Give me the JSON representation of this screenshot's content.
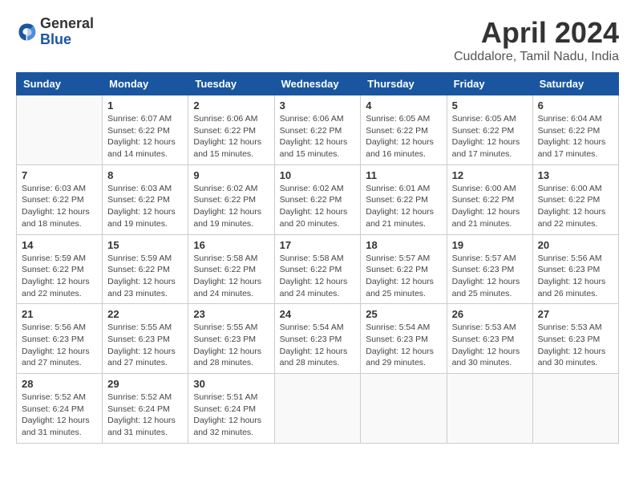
{
  "logo": {
    "general": "General",
    "blue": "Blue"
  },
  "title": "April 2024",
  "subtitle": "Cuddalore, Tamil Nadu, India",
  "days_header": [
    "Sunday",
    "Monday",
    "Tuesday",
    "Wednesday",
    "Thursday",
    "Friday",
    "Saturday"
  ],
  "weeks": [
    [
      {
        "day": "",
        "info": ""
      },
      {
        "day": "1",
        "info": "Sunrise: 6:07 AM\nSunset: 6:22 PM\nDaylight: 12 hours\nand 14 minutes."
      },
      {
        "day": "2",
        "info": "Sunrise: 6:06 AM\nSunset: 6:22 PM\nDaylight: 12 hours\nand 15 minutes."
      },
      {
        "day": "3",
        "info": "Sunrise: 6:06 AM\nSunset: 6:22 PM\nDaylight: 12 hours\nand 15 minutes."
      },
      {
        "day": "4",
        "info": "Sunrise: 6:05 AM\nSunset: 6:22 PM\nDaylight: 12 hours\nand 16 minutes."
      },
      {
        "day": "5",
        "info": "Sunrise: 6:05 AM\nSunset: 6:22 PM\nDaylight: 12 hours\nand 17 minutes."
      },
      {
        "day": "6",
        "info": "Sunrise: 6:04 AM\nSunset: 6:22 PM\nDaylight: 12 hours\nand 17 minutes."
      }
    ],
    [
      {
        "day": "7",
        "info": "Sunrise: 6:03 AM\nSunset: 6:22 PM\nDaylight: 12 hours\nand 18 minutes."
      },
      {
        "day": "8",
        "info": "Sunrise: 6:03 AM\nSunset: 6:22 PM\nDaylight: 12 hours\nand 19 minutes."
      },
      {
        "day": "9",
        "info": "Sunrise: 6:02 AM\nSunset: 6:22 PM\nDaylight: 12 hours\nand 19 minutes."
      },
      {
        "day": "10",
        "info": "Sunrise: 6:02 AM\nSunset: 6:22 PM\nDaylight: 12 hours\nand 20 minutes."
      },
      {
        "day": "11",
        "info": "Sunrise: 6:01 AM\nSunset: 6:22 PM\nDaylight: 12 hours\nand 21 minutes."
      },
      {
        "day": "12",
        "info": "Sunrise: 6:00 AM\nSunset: 6:22 PM\nDaylight: 12 hours\nand 21 minutes."
      },
      {
        "day": "13",
        "info": "Sunrise: 6:00 AM\nSunset: 6:22 PM\nDaylight: 12 hours\nand 22 minutes."
      }
    ],
    [
      {
        "day": "14",
        "info": "Sunrise: 5:59 AM\nSunset: 6:22 PM\nDaylight: 12 hours\nand 22 minutes."
      },
      {
        "day": "15",
        "info": "Sunrise: 5:59 AM\nSunset: 6:22 PM\nDaylight: 12 hours\nand 23 minutes."
      },
      {
        "day": "16",
        "info": "Sunrise: 5:58 AM\nSunset: 6:22 PM\nDaylight: 12 hours\nand 24 minutes."
      },
      {
        "day": "17",
        "info": "Sunrise: 5:58 AM\nSunset: 6:22 PM\nDaylight: 12 hours\nand 24 minutes."
      },
      {
        "day": "18",
        "info": "Sunrise: 5:57 AM\nSunset: 6:22 PM\nDaylight: 12 hours\nand 25 minutes."
      },
      {
        "day": "19",
        "info": "Sunrise: 5:57 AM\nSunset: 6:23 PM\nDaylight: 12 hours\nand 25 minutes."
      },
      {
        "day": "20",
        "info": "Sunrise: 5:56 AM\nSunset: 6:23 PM\nDaylight: 12 hours\nand 26 minutes."
      }
    ],
    [
      {
        "day": "21",
        "info": "Sunrise: 5:56 AM\nSunset: 6:23 PM\nDaylight: 12 hours\nand 27 minutes."
      },
      {
        "day": "22",
        "info": "Sunrise: 5:55 AM\nSunset: 6:23 PM\nDaylight: 12 hours\nand 27 minutes."
      },
      {
        "day": "23",
        "info": "Sunrise: 5:55 AM\nSunset: 6:23 PM\nDaylight: 12 hours\nand 28 minutes."
      },
      {
        "day": "24",
        "info": "Sunrise: 5:54 AM\nSunset: 6:23 PM\nDaylight: 12 hours\nand 28 minutes."
      },
      {
        "day": "25",
        "info": "Sunrise: 5:54 AM\nSunset: 6:23 PM\nDaylight: 12 hours\nand 29 minutes."
      },
      {
        "day": "26",
        "info": "Sunrise: 5:53 AM\nSunset: 6:23 PM\nDaylight: 12 hours\nand 30 minutes."
      },
      {
        "day": "27",
        "info": "Sunrise: 5:53 AM\nSunset: 6:23 PM\nDaylight: 12 hours\nand 30 minutes."
      }
    ],
    [
      {
        "day": "28",
        "info": "Sunrise: 5:52 AM\nSunset: 6:24 PM\nDaylight: 12 hours\nand 31 minutes."
      },
      {
        "day": "29",
        "info": "Sunrise: 5:52 AM\nSunset: 6:24 PM\nDaylight: 12 hours\nand 31 minutes."
      },
      {
        "day": "30",
        "info": "Sunrise: 5:51 AM\nSunset: 6:24 PM\nDaylight: 12 hours\nand 32 minutes."
      },
      {
        "day": "",
        "info": ""
      },
      {
        "day": "",
        "info": ""
      },
      {
        "day": "",
        "info": ""
      },
      {
        "day": "",
        "info": ""
      }
    ]
  ]
}
